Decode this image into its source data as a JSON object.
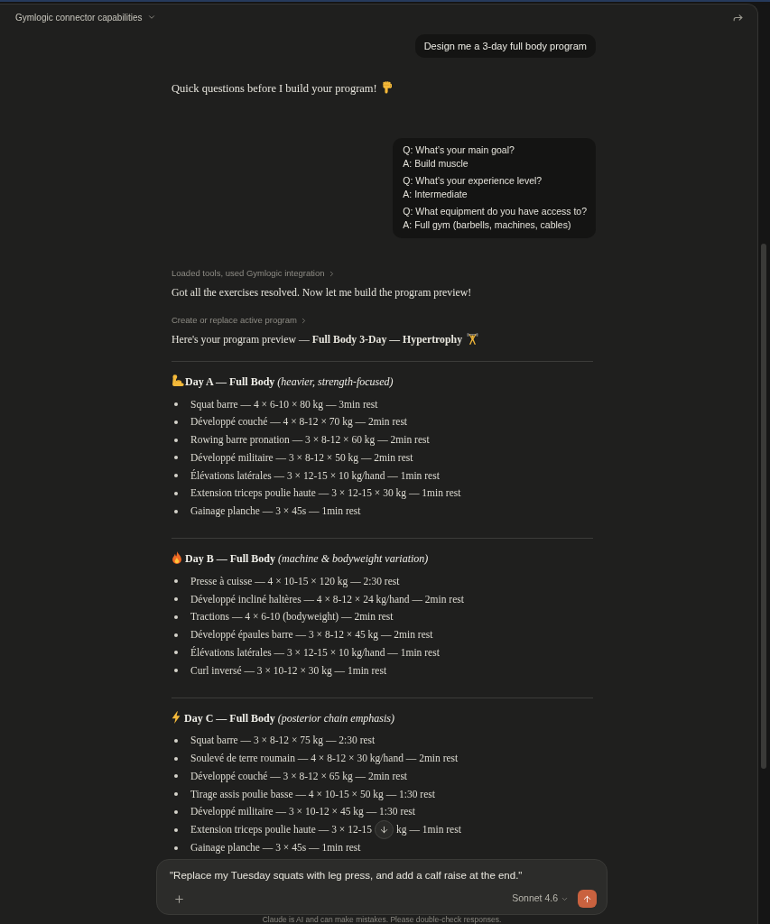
{
  "header": {
    "title": "Gymlogic connector capabilities"
  },
  "user_message": {
    "text": "Design me a 3-day full body program"
  },
  "assistant_intro": {
    "text": "Quick questions before I build your program!"
  },
  "answers_bubble": {
    "pairs": [
      {
        "question": "Q: What’s your main goal?",
        "answer": "A: Build muscle"
      },
      {
        "question": "Q: What’s your experience level?",
        "answer": "A: Intermediate"
      },
      {
        "question": "Q: What equipment do you have access to?",
        "answer": "A: Full gym (barbells, machines, cables)"
      }
    ]
  },
  "tool_steps": [
    {
      "label": "Loaded tools, used Gymlogic integration",
      "text": "Got all the exercises resolved. Now let me build the program preview!"
    },
    {
      "label": "Create or replace active program",
      "text": "Here's your program preview — **Full Body 3-Day — Hypertrophy**"
    }
  ],
  "days": [
    {
      "heading": "**Day A — Full Body** *(heavier, strength-focused)*",
      "exercises": [
        {
          "text": "Squat barre — 4 × 6-10 × 80 kg — 3min rest"
        },
        {
          "text": "Développé couché — 4 × 8-12 × 70 kg — 2min rest"
        },
        {
          "text": "Rowing barre pronation — 3 × 8-12 × 60 kg — 2min rest"
        },
        {
          "text": "Développé militaire — 3 × 8-12 × 50 kg — 2min rest"
        },
        {
          "text": "Élévations latérales — 3 × 12-15 × 10 kg/hand — 1min rest"
        },
        {
          "text": "Extension triceps poulie haute — 3 × 12-15 × 30 kg — 1min rest"
        },
        {
          "text": "Gainage planche — 3 × 45s — 1min rest"
        }
      ]
    },
    {
      "heading": "**Day B — Full Body** *(machine & bodyweight variation)*",
      "exercises": [
        {
          "text": "Presse à cuisse — 4 × 10-15 × 120 kg — 2:30 rest"
        },
        {
          "text": "Développé incliné haltères — 4 × 8-12 × 24 kg/hand — 2min rest"
        },
        {
          "text": "Tractions — 4 × 6-10 (bodyweight) — 2min rest"
        },
        {
          "text": "Développé épaules barre — 3 × 8-12 × 45 kg — 2min rest"
        },
        {
          "text": "Élévations latérales — 3 × 12-15 × 10 kg/hand — 1min rest"
        },
        {
          "text": "Curl inversé — 3 × 10-12 × 30 kg — 1min rest"
        }
      ]
    },
    {
      "heading": "**Day C — Full Body** *(posterior chain emphasis)*",
      "exercises": [
        {
          "text": "Squat barre — 3 × 8-12 × 75 kg — 2:30 rest"
        },
        {
          "text": "Soulevé de terre roumain — 4 × 8-12 × 30 kg/hand — 2min rest"
        },
        {
          "text": "Développé couché — 3 × 8-12 × 65 kg — 2min rest"
        },
        {
          "text": "Tirage assis poulie basse — 4 × 10-15 × 50 kg — 1:30 rest"
        },
        {
          "text": "Développé militaire — 3 × 10-12 × 45 kg — 1:30 rest"
        },
        {
          "text": "Extension triceps poulie haute — 3 × 12-15",
          "text_after": "kg — 1min rest"
        },
        {
          "text": "Gainage planche — 3 × 45s — 1min rest"
        }
      ]
    }
  ],
  "composer": {
    "value": "\"Replace my Tuesday squats with leg press, and add a calf raise at the end.\"",
    "model": "Sonnet 4.6"
  },
  "disclaimer": "Claude is AI and can make mistakes. Please double-check responses."
}
